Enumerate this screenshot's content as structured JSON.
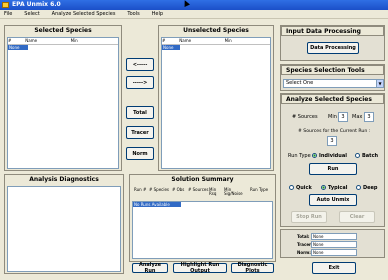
{
  "window": {
    "title": "EPA Unmix 6.0"
  },
  "menu": [
    "File",
    "Select",
    "Analyze Selected Species",
    "Tools",
    "Help"
  ],
  "selected_species": {
    "title": "Selected Species",
    "columns": [
      "#",
      "Name",
      "Min"
    ],
    "rows": [
      "None"
    ]
  },
  "unselected_species": {
    "title": "Unselected Species",
    "columns": [
      "#",
      "Name",
      "Min"
    ],
    "rows": [
      "None"
    ]
  },
  "move_buttons": {
    "left": "<-----",
    "right": "----->"
  },
  "side_buttons": {
    "total": "Total",
    "tracer": "Tracer",
    "norm": "Norm"
  },
  "analysis_diagnostics": {
    "title": "Analysis Diagnostics"
  },
  "solution_summary": {
    "title": "Solution Summary",
    "columns": [
      "Run #",
      "# Species",
      "# Obs",
      "# Sources",
      "Min Rsq",
      "Min Sig/Noise",
      "Run Type"
    ],
    "rows": [
      "No Runs Available"
    ]
  },
  "bottom_buttons": {
    "analyze": "Analyze Run",
    "highlight": "Highlight Run Output",
    "diagnostic": "Diagnostic Plots"
  },
  "input_processing": {
    "title": "Input Data Processing",
    "button": "Data Processing"
  },
  "selection_tools": {
    "title": "Species Selection Tools",
    "select_value": "Select One"
  },
  "analyze_species": {
    "title": "Analyze Selected Species",
    "sources_label": "# Sources",
    "min_label": "Min",
    "min_value": "3",
    "max_label": "Max",
    "max_value": "3",
    "current_run_label": "# Sources for the Current Run :",
    "current_run_value": "3",
    "run_type_label": "Run Type",
    "individual_label": "Individual",
    "batch_label": "Batch",
    "run_button": "Run",
    "quick_label": "Quick",
    "typical_label": "Typical",
    "deep_label": "Deep",
    "auto_button": "Auto Unmix",
    "stop_button": "Stop Run",
    "clear_button": "Clear"
  },
  "assign": {
    "total_label": "Total:",
    "total_value": "None",
    "tracer_label": "Tracer:",
    "tracer_value": "None",
    "norm_label": "Norm:",
    "norm_value": "None"
  },
  "exit_button": "Exit"
}
